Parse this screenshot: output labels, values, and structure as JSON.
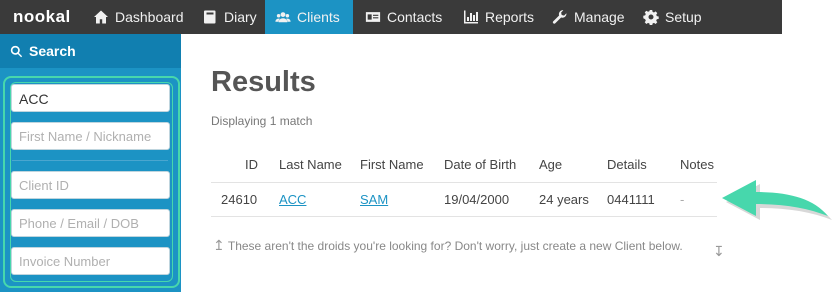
{
  "app": {
    "logo": "nookal"
  },
  "nav": {
    "items": [
      {
        "label": "Dashboard",
        "icon": "home-icon"
      },
      {
        "label": "Diary",
        "icon": "book-icon"
      },
      {
        "label": "Clients",
        "icon": "users-icon",
        "active": true
      },
      {
        "label": "Contacts",
        "icon": "id-card-icon"
      },
      {
        "label": "Reports",
        "icon": "bar-chart-icon"
      },
      {
        "label": "Manage",
        "icon": "wrench-icon"
      },
      {
        "label": "Setup",
        "icon": "gear-icon"
      }
    ]
  },
  "sidebar": {
    "title": "Search",
    "fields": {
      "last_name": {
        "value": "ACC"
      },
      "first_name": {
        "placeholder": "First Name / Nickname"
      },
      "client_id": {
        "placeholder": "Client ID"
      },
      "phone": {
        "placeholder": "Phone / Email / DOB"
      },
      "invoice": {
        "placeholder": "Invoice Number"
      }
    }
  },
  "main": {
    "title": "Results",
    "subtitle": "Displaying 1 match",
    "columns": [
      "ID",
      "Last Name",
      "First Name",
      "Date of Birth",
      "Age",
      "Details",
      "Notes"
    ],
    "rows": [
      {
        "id": "24610",
        "last_name": "ACC",
        "first_name": "SAM",
        "dob": "19/04/2000",
        "age": "24 years",
        "details": "0441111",
        "notes": "-"
      }
    ],
    "note": "These aren't the droids you're looking for? Don't worry, just create a new Client below."
  },
  "colors": {
    "topbar": "#3a3a3a",
    "accent": "#1c93c4",
    "highlight": "#47d7ac"
  }
}
